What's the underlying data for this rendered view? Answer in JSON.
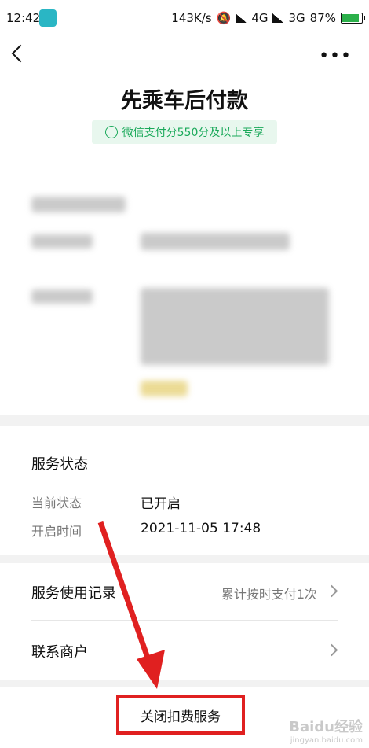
{
  "status_bar": {
    "time": "12:42",
    "net_speed": "143K/s",
    "signal_text": "4G",
    "signal_text_2": "3G",
    "battery": "87%",
    "battery_level": 0.87
  },
  "header": {
    "title": "先乘车后付款",
    "badge": "微信支付分550分及以上专享"
  },
  "service_status": {
    "title": "服务状态",
    "current_label": "当前状态",
    "current_value": "已开启",
    "start_label": "开启时间",
    "start_value": "2021-11-05 17:48"
  },
  "rows": {
    "usage_title": "服务使用记录",
    "usage_value": "累计按时支付1次",
    "contact_title": "联系商户"
  },
  "footer": {
    "close_label": "关闭扣费服务"
  },
  "watermark": {
    "text": "Baidu经验",
    "sub": "jingyan.baidu.com"
  },
  "colors": {
    "accent_green": "#1aa95a",
    "highlight_red": "#e02020"
  }
}
